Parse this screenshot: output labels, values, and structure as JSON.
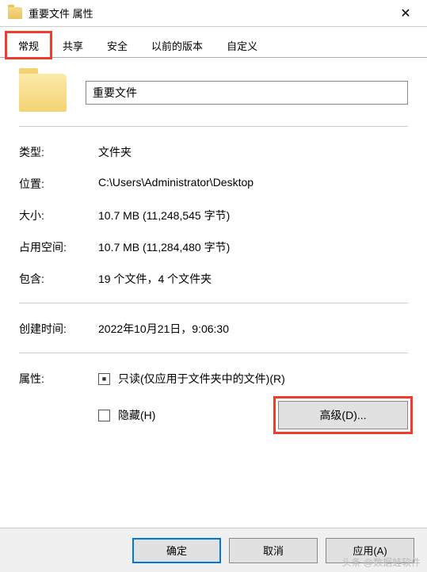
{
  "titlebar": {
    "text": "重要文件 属性",
    "close": "✕"
  },
  "tabs": {
    "items": [
      {
        "label": "常规"
      },
      {
        "label": "共享"
      },
      {
        "label": "安全"
      },
      {
        "label": "以前的版本"
      },
      {
        "label": "自定义"
      }
    ]
  },
  "folder": {
    "name": "重要文件"
  },
  "info": {
    "type_label": "类型:",
    "type_value": "文件夹",
    "location_label": "位置:",
    "location_value": "C:\\Users\\Administrator\\Desktop",
    "size_label": "大小:",
    "size_value": "10.7 MB (11,248,545 字节)",
    "diskSize_label": "占用空间:",
    "diskSize_value": "10.7 MB (11,284,480 字节)",
    "contains_label": "包含:",
    "contains_value": "19 个文件，4 个文件夹",
    "created_label": "创建时间:",
    "created_value": "2022年10月21日，9:06:30"
  },
  "attributes": {
    "label": "属性:",
    "readonly_checked": true,
    "readonly_text": "只读(仅应用于文件夹中的文件)(R)",
    "hidden_checked": false,
    "hidden_text": "隐藏(H)",
    "advanced_button": "高级(D)..."
  },
  "buttons": {
    "ok": "确定",
    "cancel": "取消",
    "apply": "应用(A)"
  },
  "watermark": "头条 @数据蛙软件"
}
